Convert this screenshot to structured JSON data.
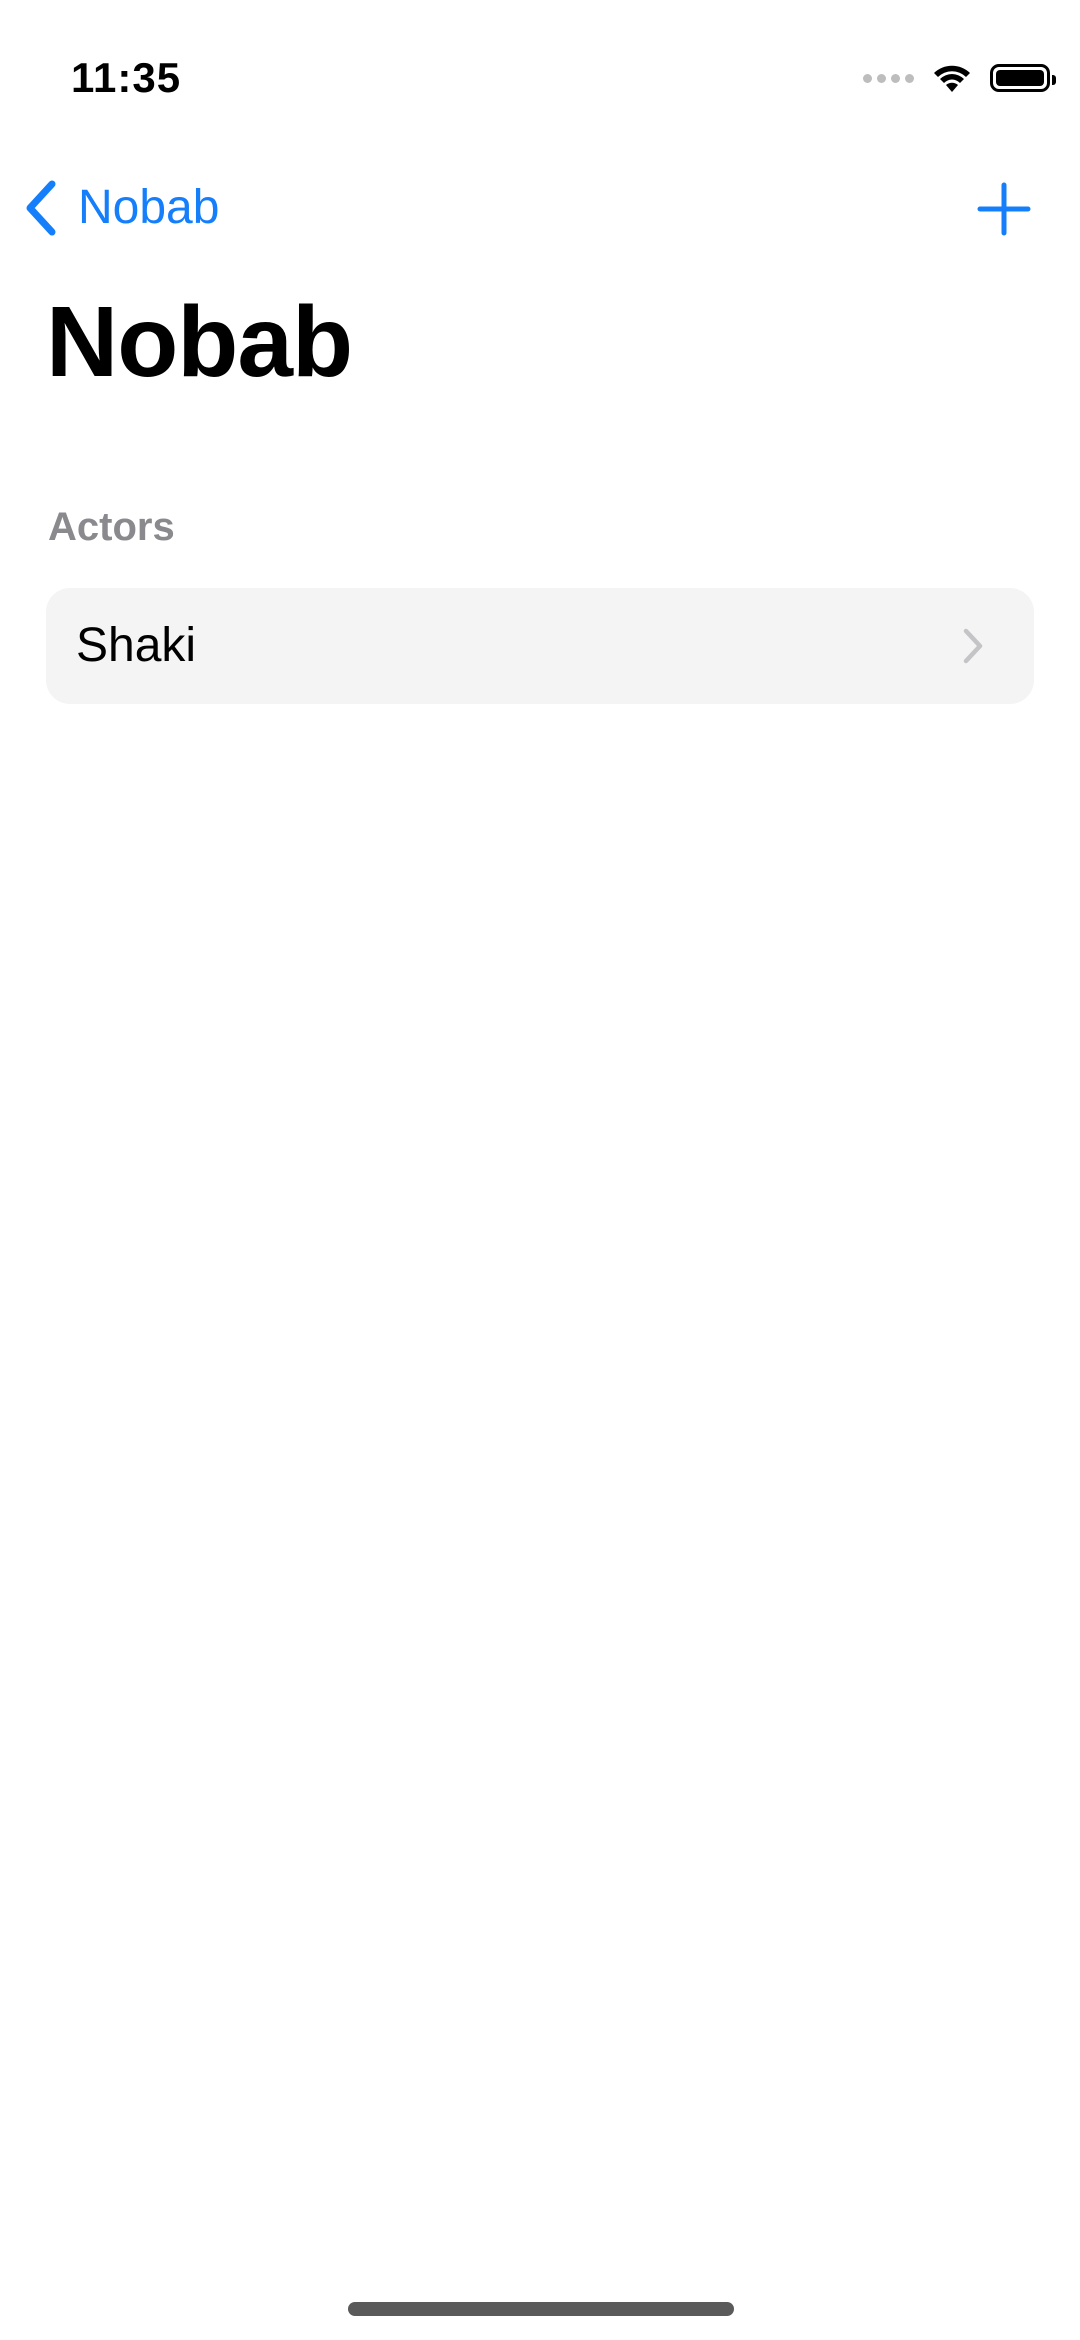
{
  "status_bar": {
    "time": "11:35",
    "icons": [
      "signal-dots-icon",
      "wifi-icon",
      "battery-icon"
    ]
  },
  "nav": {
    "back_label": "Nobab",
    "back_icon": "chevron-left-icon",
    "add_icon": "plus-icon",
    "accent_color": "#147EFB"
  },
  "page": {
    "title": "Nobab"
  },
  "section": {
    "header": "Actors",
    "items": [
      {
        "label": "Shaki",
        "icon": "chevron-right-icon"
      }
    ]
  },
  "colors": {
    "background": "#FFFFFF",
    "row_background": "#F4F4F4",
    "section_header": "#8A8A8E",
    "chevron": "#C4C4C7"
  }
}
